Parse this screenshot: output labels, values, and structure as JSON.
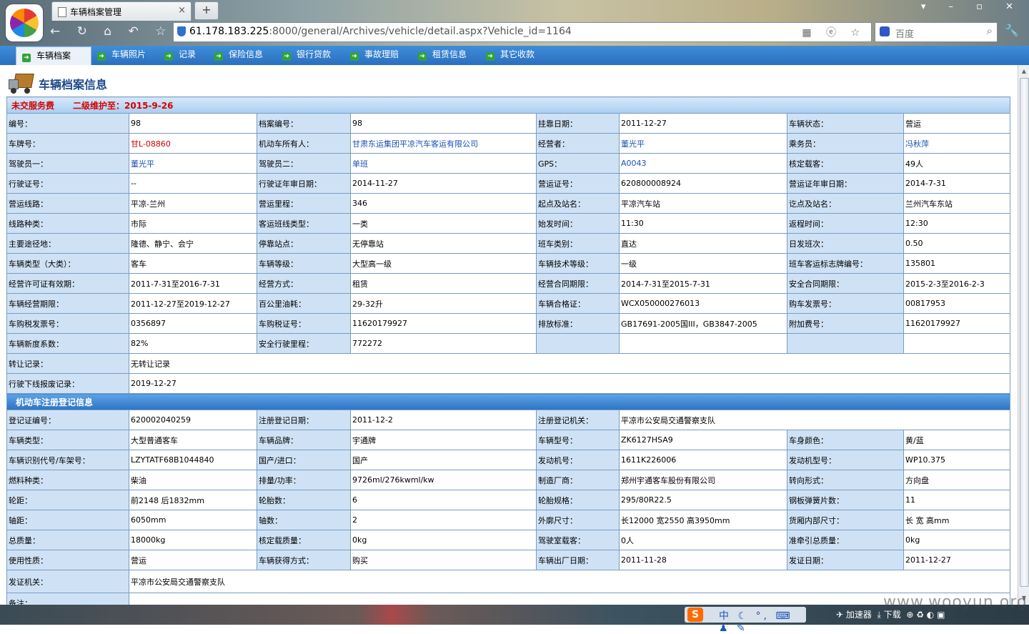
{
  "browser": {
    "tab_title": "车辆档案管理",
    "tab_close": "×",
    "new_tab": "+",
    "url_host": "61.178.183.225",
    "url_rest": ":8000/general/Archives/vehicle/detail.aspx?Vehicle_id=1164",
    "search_placeholder": "百度",
    "window_controls": "▾ – ▫ ✕",
    "nav_icons": "← ↻ ⌂ ↶ ☆ ⊞"
  },
  "menu": {
    "items": [
      {
        "label": "车辆档案",
        "active": true
      },
      {
        "label": "车辆照片"
      },
      {
        "label": "记录"
      },
      {
        "label": "保险信息"
      },
      {
        "label": "银行贷款"
      },
      {
        "label": "事故理赔"
      },
      {
        "label": "租赁信息"
      },
      {
        "label": "其它收款"
      }
    ]
  },
  "page": {
    "title": "车辆档案信息",
    "status_unpaid": "未交服务费",
    "status_maintenance": "二级维护至：2015-9-26"
  },
  "rows": [
    [
      {
        "l": "编号："
      },
      {
        "v": "98"
      },
      {
        "l": "档案编号："
      },
      {
        "v": "98"
      },
      {
        "l": "挂靠日期："
      },
      {
        "v": "2011-12-27"
      },
      {
        "l": "车辆状态："
      },
      {
        "v": "营运"
      }
    ],
    [
      {
        "l": "车牌号："
      },
      {
        "v": "甘L-08860",
        "c": "red"
      },
      {
        "l": "机动车所有人："
      },
      {
        "v": "甘肃东运集团平凉汽车客运有限公司",
        "c": "blue"
      },
      {
        "l": "经营者："
      },
      {
        "v": "董光平",
        "c": "blue"
      },
      {
        "l": "乘务员："
      },
      {
        "v": "冯秋萍",
        "c": "blue"
      }
    ],
    [
      {
        "l": "驾驶员一："
      },
      {
        "v": "董光平",
        "c": "blue"
      },
      {
        "l": "驾驶员二："
      },
      {
        "v": "单班",
        "c": "blue"
      },
      {
        "l": "GPS："
      },
      {
        "v": "A0043",
        "c": "blue"
      },
      {
        "l": "核定载客："
      },
      {
        "v": "49人"
      }
    ],
    [
      {
        "l": "行驶证号："
      },
      {
        "v": "--"
      },
      {
        "l": "行驶证年审日期："
      },
      {
        "v": "2014-11-27"
      },
      {
        "l": "营运证号："
      },
      {
        "v": "620800008924"
      },
      {
        "l": "营运证年审日期："
      },
      {
        "v": "2014-7-31"
      }
    ],
    [
      {
        "l": "营运线路："
      },
      {
        "v": "平凉-兰州"
      },
      {
        "l": "营运里程："
      },
      {
        "v": "346"
      },
      {
        "l": "起点及站名："
      },
      {
        "v": "平凉汽车站"
      },
      {
        "l": "讫点及站名："
      },
      {
        "v": "兰州汽车东站"
      }
    ],
    [
      {
        "l": "线路种类："
      },
      {
        "v": "市际"
      },
      {
        "l": "客运班线类型："
      },
      {
        "v": "一类"
      },
      {
        "l": "始发时间："
      },
      {
        "v": "11:30"
      },
      {
        "l": "返程时间："
      },
      {
        "v": "12:30"
      }
    ],
    [
      {
        "l": "主要途径地："
      },
      {
        "v": "隆德、静宁、会宁"
      },
      {
        "l": "停靠站点："
      },
      {
        "v": "无停靠站"
      },
      {
        "l": "班车类别："
      },
      {
        "v": "直达"
      },
      {
        "l": "日发班次："
      },
      {
        "v": "0.50"
      }
    ],
    [
      {
        "l": "车辆类型（大类）："
      },
      {
        "v": "客车"
      },
      {
        "l": "车辆等级："
      },
      {
        "v": "大型高一级"
      },
      {
        "l": "车辆技术等级："
      },
      {
        "v": "一级"
      },
      {
        "l": "班车客运标志牌编号："
      },
      {
        "v": "135801"
      }
    ],
    [
      {
        "l": "经营许可证有效期："
      },
      {
        "v": "2011-7-31至2016-7-31"
      },
      {
        "l": "经营方式："
      },
      {
        "v": "租赁"
      },
      {
        "l": "经营合同期限："
      },
      {
        "v": "2014-7-31至2015-7-31"
      },
      {
        "l": "安全合同期限："
      },
      {
        "v": "2015-2-3至2016-2-3"
      }
    ],
    [
      {
        "l": "车辆经营期限："
      },
      {
        "v": "2011-12-27至2019-12-27"
      },
      {
        "l": "百公里油耗："
      },
      {
        "v": "29-32升"
      },
      {
        "l": "车辆合格证："
      },
      {
        "v": "WCX050000276013"
      },
      {
        "l": "购车发票号："
      },
      {
        "v": "00817953"
      }
    ],
    [
      {
        "l": "车购税发票号："
      },
      {
        "v": "0356897"
      },
      {
        "l": "车购税证号："
      },
      {
        "v": "11620179927"
      },
      {
        "l": "排放标准："
      },
      {
        "v": "GB17691-2005国III，GB3847-2005"
      },
      {
        "l": "附加费号："
      },
      {
        "v": "11620179927"
      }
    ],
    [
      {
        "l": "车辆新度系数："
      },
      {
        "v": "82%"
      },
      {
        "l": "安全行驶里程："
      },
      {
        "v": "772272"
      },
      {
        "l": ""
      },
      {
        "v": ""
      },
      {
        "l": ""
      },
      {
        "v": ""
      }
    ]
  ],
  "wide_rows": [
    {
      "l": "转让记录：",
      "v": "无转让记录"
    },
    {
      "l": "行驶下线报废记录：",
      "v": "2019-12-27"
    }
  ],
  "section2_title": "机动车注册登记信息",
  "reg_row0": [
    {
      "l": "登记证编号："
    },
    {
      "v": "620002040259"
    },
    {
      "l": "注册登记日期："
    },
    {
      "v": "2011-12-2"
    },
    {
      "l": "注册登记机关："
    },
    {
      "v": "平凉市公安局交通警察支队"
    }
  ],
  "rows2": [
    [
      {
        "l": "车辆类型："
      },
      {
        "v": "大型普通客车"
      },
      {
        "l": "车辆品牌："
      },
      {
        "v": "宇通牌"
      },
      {
        "l": "车辆型号："
      },
      {
        "v": "ZK6127HSA9"
      },
      {
        "l": "车身颜色："
      },
      {
        "v": "黄/蓝"
      }
    ],
    [
      {
        "l": "车辆识别代号/车架号："
      },
      {
        "v": "LZYTATF68B1044840"
      },
      {
        "l": "国产/进口："
      },
      {
        "v": "国产"
      },
      {
        "l": "发动机号："
      },
      {
        "v": "1611K226006"
      },
      {
        "l": "发动机型号："
      },
      {
        "v": "WP10.375"
      }
    ],
    [
      {
        "l": "燃料种类："
      },
      {
        "v": "柴油"
      },
      {
        "l": "排量/功率："
      },
      {
        "v": "9726ml/276kwml/kw"
      },
      {
        "l": "制造厂商："
      },
      {
        "v": "郑州宇通客车股份有限公司"
      },
      {
        "l": "转向形式："
      },
      {
        "v": "方向盘"
      }
    ],
    [
      {
        "l": "轮距："
      },
      {
        "v": "前2148 后1832mm"
      },
      {
        "l": "轮胎数："
      },
      {
        "v": "6"
      },
      {
        "l": "轮胎规格："
      },
      {
        "v": "295/80R22.5"
      },
      {
        "l": "钢板弹簧片数："
      },
      {
        "v": "11"
      }
    ],
    [
      {
        "l": "轴距："
      },
      {
        "v": "6050mm"
      },
      {
        "l": "轴数："
      },
      {
        "v": "2"
      },
      {
        "l": "外廓尺寸："
      },
      {
        "v": "长12000 宽2550 高3950mm"
      },
      {
        "l": "货厢内部尺寸："
      },
      {
        "v": "长  宽  高mm"
      }
    ],
    [
      {
        "l": "总质量："
      },
      {
        "v": "18000kg"
      },
      {
        "l": "核定载质量："
      },
      {
        "v": "0kg"
      },
      {
        "l": "驾驶室载客："
      },
      {
        "v": "0人"
      },
      {
        "l": "准牵引总质量："
      },
      {
        "v": "0kg"
      }
    ],
    [
      {
        "l": "使用性质："
      },
      {
        "v": "营运"
      },
      {
        "l": "车辆获得方式："
      },
      {
        "v": "购买"
      },
      {
        "l": "车辆出厂日期："
      },
      {
        "v": "2011-11-28"
      },
      {
        "l": "发证日期："
      },
      {
        "v": "2011-12-27"
      }
    ]
  ],
  "issue_row": {
    "l": "发证机关：",
    "v": "平凉市公安局交通警察支队"
  },
  "remark_row": {
    "l": "备注：",
    "v": ""
  },
  "taskbar": {
    "ime_logo": "S",
    "ime_text": "中 ☾ °, ⌨ ♟ ✎",
    "tray_accelerator": "加速器",
    "tray_download": "下载",
    "tray_icons": "⊕ ♻ ◐ ▣"
  },
  "watermark": "www.wooyun.org"
}
